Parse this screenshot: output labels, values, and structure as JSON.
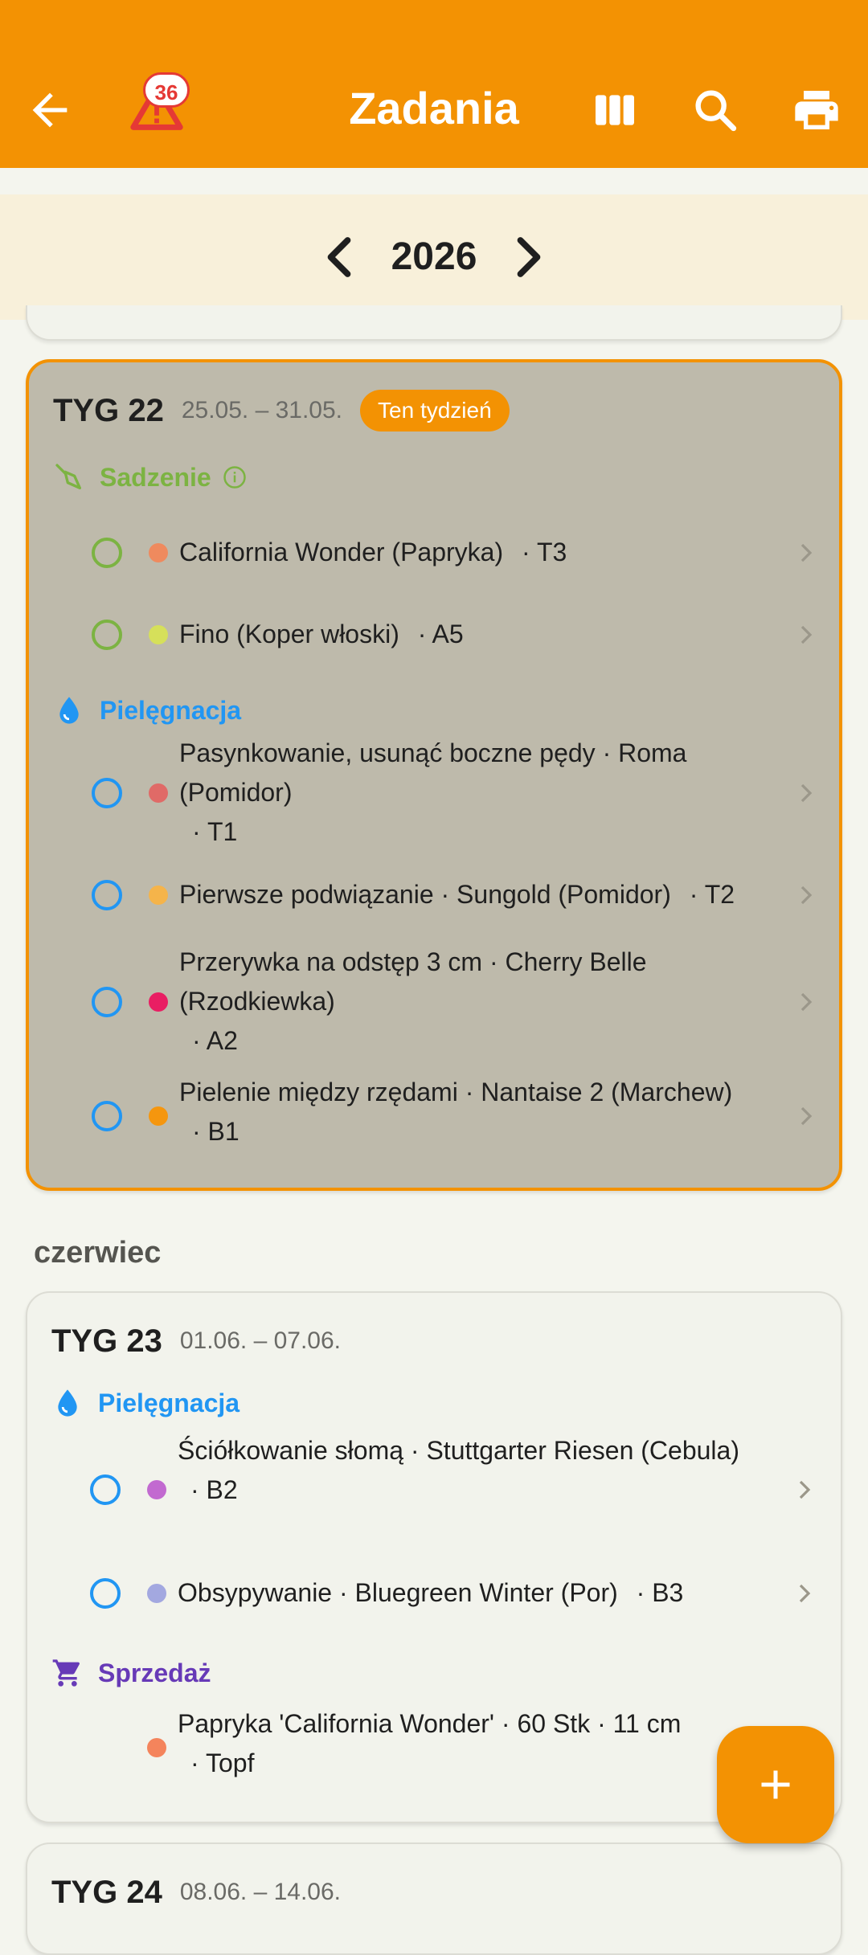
{
  "app_bar": {
    "title": "Zadania",
    "warning_count": "36",
    "icons": [
      "back-arrow-icon",
      "warning-icon",
      "columns-icon",
      "search-icon",
      "print-icon"
    ]
  },
  "year_nav": {
    "year": "2026"
  },
  "colors": {
    "primary": "#f39203",
    "sowing": "#7cb342",
    "care": "#2196f3",
    "sales": "#673ab7"
  },
  "weeks": [
    {
      "label": "TYG 22",
      "range": "25.05. – 31.05.",
      "badge": "Ten tydzień",
      "categories": [
        {
          "label": "Sadzenie",
          "tasks": [
            {
              "text": "California Wonder (Papryka)",
              "bed": "· T3",
              "dot": "#ef8a5e"
            },
            {
              "text": "Fino (Koper włoski)",
              "bed": "· A5",
              "dot": "#d6e05a"
            }
          ]
        },
        {
          "label": "Pielęgnacja",
          "tasks": [
            {
              "text": "Pasynkowanie, usunąć boczne pędy · Roma (Pomidor)",
              "bed": "· T1",
              "dot": "#e06a67"
            },
            {
              "text": "Pierwsze podwiązanie · Sungold (Pomidor)",
              "bed": "· T2",
              "dot": "#f5b44a"
            },
            {
              "text": "Przerywka na odstęp 3 cm · Cherry Belle (Rzodkiewka)",
              "bed": "· A2",
              "dot": "#e91e63"
            },
            {
              "text": "Pielenie między rzędami · Nantaise 2 (Marchew)",
              "bed": "· B1",
              "dot": "#f5960e"
            }
          ]
        }
      ]
    },
    {
      "label": "TYG 23",
      "range": "01.06. – 07.06.",
      "categories": [
        {
          "label": "Pielęgnacja",
          "tasks": [
            {
              "text": "Ściółkowanie słomą · Stuttgarter Riesen (Cebula)",
              "bed": "· B2",
              "dot": "#c26ad0"
            },
            {
              "text": "Obsypywanie · Bluegreen Winter (Por)",
              "bed": "· B3",
              "dot": "#a3a8e0"
            }
          ]
        },
        {
          "label": "Sprzedaż",
          "tasks": [
            {
              "text": "Papryka 'California Wonder' · 60 Stk · 11 cm",
              "bed": "· Topf",
              "dot": "#f4845c"
            }
          ]
        }
      ]
    },
    {
      "label": "TYG 24",
      "range": "08.06. – 14.06."
    }
  ],
  "month_header": "czerwiec"
}
